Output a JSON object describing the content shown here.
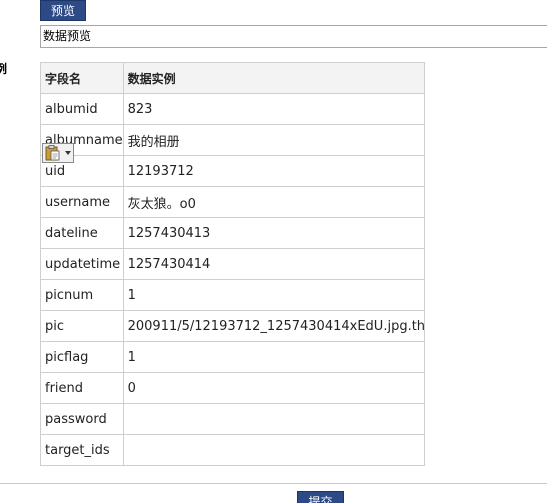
{
  "toolbar": {
    "preview_label": "预览"
  },
  "title_field": {
    "value": "数据预览"
  },
  "side_label": "例",
  "table": {
    "headers": [
      "字段名",
      "数据实例"
    ],
    "rows": [
      {
        "field": "albumid",
        "value": "823"
      },
      {
        "field": "albumname",
        "value": "我的相册"
      },
      {
        "field": "uid",
        "value": "12193712"
      },
      {
        "field": "username",
        "value": "灰太狼。o0"
      },
      {
        "field": "dateline",
        "value": "1257430413"
      },
      {
        "field": "updatetime",
        "value": "1257430414"
      },
      {
        "field": "picnum",
        "value": "1"
      },
      {
        "field": "pic",
        "value": "200911/5/12193712_1257430414xEdU.jpg.th"
      },
      {
        "field": "picflag",
        "value": "1"
      },
      {
        "field": "friend",
        "value": "0"
      },
      {
        "field": "password",
        "value": ""
      },
      {
        "field": "target_ids",
        "value": ""
      }
    ]
  },
  "footer": {
    "submit_label": "提交"
  },
  "colors": {
    "button_bg": "#2c4a86",
    "header_bg": "#f3f3f3",
    "border": "#cfcfcf"
  },
  "icons": {
    "paste": "clipboard-paste-icon"
  }
}
